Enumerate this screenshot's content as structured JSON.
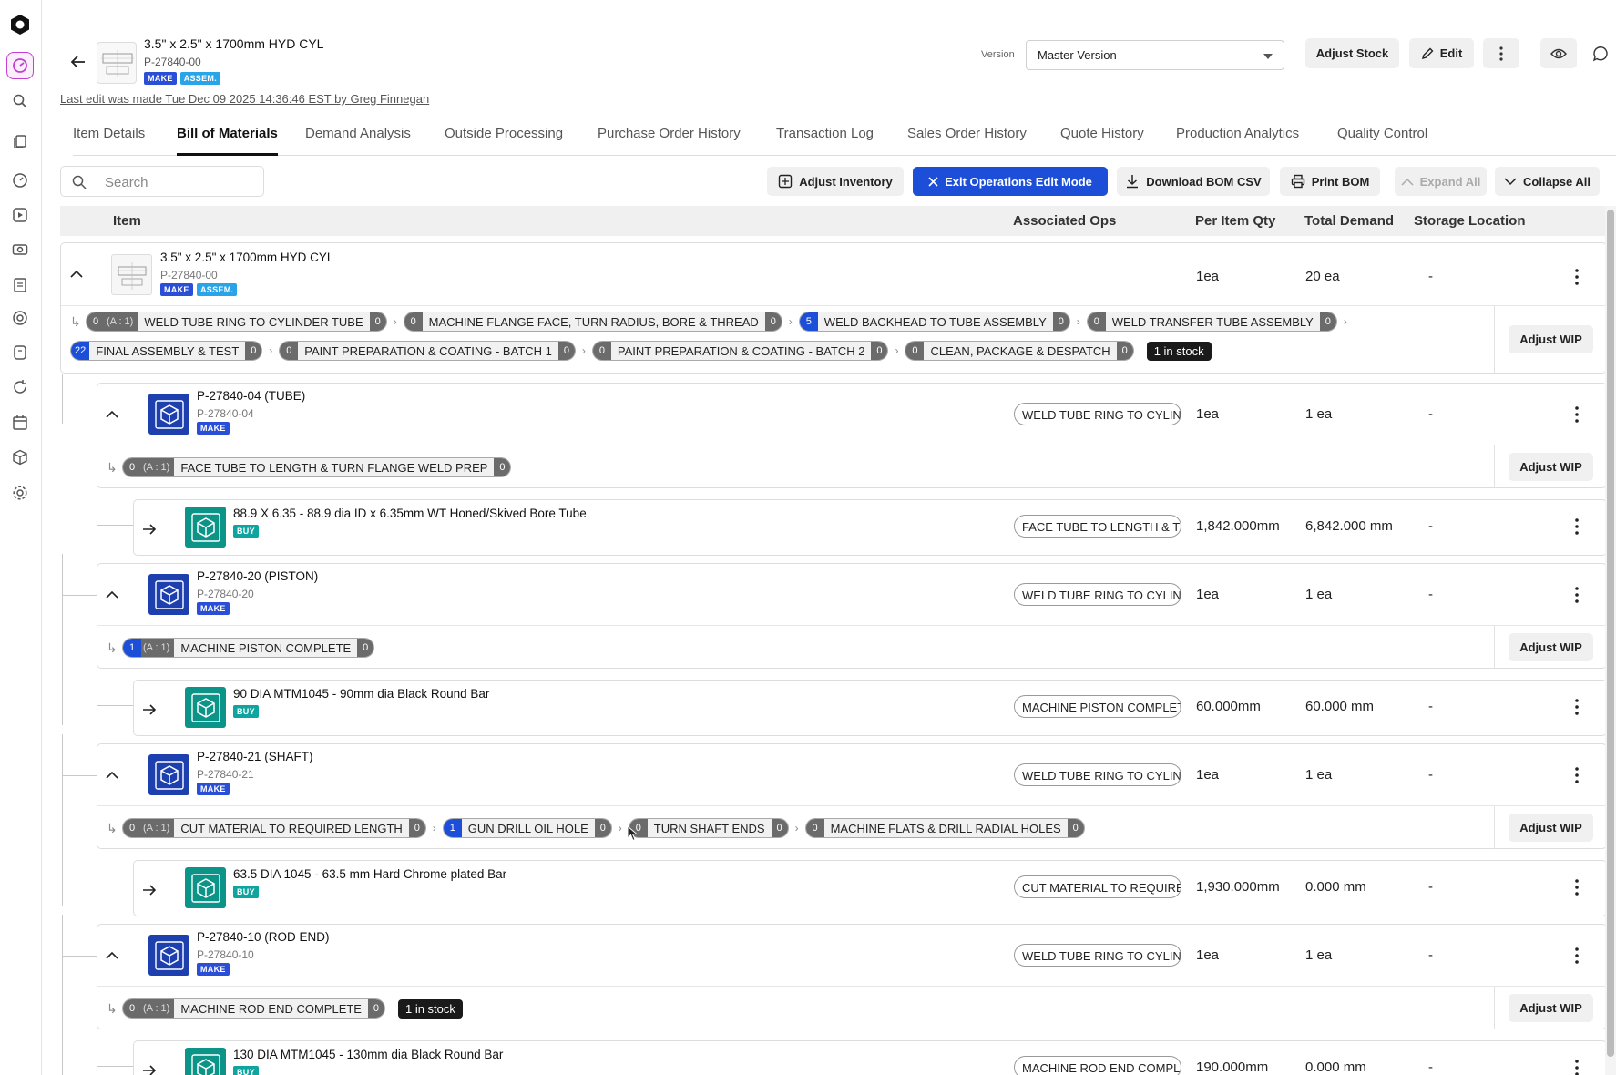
{
  "header": {
    "title": "3.5\" x 2.5\" x 1700mm HYD CYL",
    "part_number": "P-27840-00",
    "tag_make": "MAKE",
    "tag_assem": "ASSEM.",
    "last_edit": "Last edit was made Tue Dec 09 2025 14:36:46 EST by Greg Finnegan",
    "version_label": "Version",
    "version_value": "Master Version",
    "adjust_stock": "Adjust Stock",
    "edit": "Edit"
  },
  "tabs": [
    "Item Details",
    "Bill of Materials",
    "Demand Analysis",
    "Outside Processing",
    "Purchase Order History",
    "Transaction Log",
    "Sales Order History",
    "Quote History",
    "Production Analytics",
    "Quality Control"
  ],
  "toolbar": {
    "search_placeholder": "Search",
    "adjust_inventory": "Adjust Inventory",
    "exit_ops": "Exit Operations Edit Mode",
    "download_csv": "Download BOM CSV",
    "print_bom": "Print BOM",
    "expand_all": "Expand All",
    "collapse_all": "Collapse All"
  },
  "columns": {
    "item": "Item",
    "ops": "Associated Ops",
    "per_item": "Per Item Qty",
    "total": "Total Demand",
    "storage": "Storage Location"
  },
  "labels": {
    "adjust_wip": "Adjust WIP",
    "make": "MAKE",
    "buy": "BUY",
    "assem": "ASSEM.",
    "alloc": "(A : 1)"
  },
  "root": {
    "name": "3.5\" x 2.5\" x 1700mm HYD CYL",
    "pn": "P-27840-00",
    "qty": "1ea",
    "demand": "20 ea",
    "storage": "-",
    "ops_line1": [
      {
        "c": "0",
        "n": "WELD TUBE RING TO CYLINDER TUBE",
        "r": "0",
        "a": true
      },
      {
        "c": "0",
        "n": "MACHINE FLANGE FACE, TURN RADIUS, BORE & THREAD",
        "r": "0"
      },
      {
        "c": "5",
        "n": "WELD BACKHEAD TO TUBE ASSEMBLY",
        "r": "0",
        "blue": true
      },
      {
        "c": "0",
        "n": "WELD TRANSFER TUBE ASSEMBLY",
        "r": "0"
      }
    ],
    "ops_line2": [
      {
        "c": "22",
        "n": "FINAL ASSEMBLY & TEST",
        "r": "0",
        "blue": true
      },
      {
        "c": "0",
        "n": "PAINT PREPARATION & COATING - BATCH 1",
        "r": "0"
      },
      {
        "c": "0",
        "n": "PAINT PREPARATION & COATING - BATCH 2",
        "r": "0"
      },
      {
        "c": "0",
        "n": "CLEAN, PACKAGE & DESPATCH",
        "r": "0"
      }
    ],
    "stock": "1 in stock"
  },
  "subs": [
    {
      "name": "P-27840-04 (TUBE)",
      "pn": "P-27840-04",
      "op": "WELD TUBE RING TO CYLINDER TUBE",
      "qty": "1ea",
      "demand": "1 ea",
      "storage": "-",
      "ops": [
        {
          "c": "0",
          "n": "FACE TUBE TO LENGTH & TURN FLANGE WELD PREP",
          "r": "0",
          "a": true
        }
      ],
      "child": {
        "name": "88.9 X 6.35 - 88.9 dia ID x 6.35mm WT Honed/Skived Bore Tube",
        "op": "FACE TUBE TO LENGTH & TURN FLANGE WELD PREP",
        "qty": "1,842.000mm",
        "demand": "6,842.000 mm",
        "storage": "-"
      }
    },
    {
      "name": "P-27840-20 (PISTON)",
      "pn": "P-27840-20",
      "op": "WELD TUBE RING TO CYLINDER TUBE",
      "qty": "1ea",
      "demand": "1 ea",
      "storage": "-",
      "ops": [
        {
          "c": "1",
          "n": "MACHINE PISTON COMPLETE",
          "r": "0",
          "a": true,
          "blue": true
        }
      ],
      "child": {
        "name": "90 DIA MTM1045 - 90mm dia Black Round Bar",
        "op": "MACHINE PISTON COMPLETE",
        "qty": "60.000mm",
        "demand": "60.000 mm",
        "storage": "-"
      }
    },
    {
      "name": "P-27840-21 (SHAFT)",
      "pn": "P-27840-21",
      "op": "WELD TUBE RING TO CYLINDER TUBE",
      "qty": "1ea",
      "demand": "1 ea",
      "storage": "-",
      "ops": [
        {
          "c": "0",
          "n": "CUT MATERIAL TO REQUIRED LENGTH",
          "r": "0",
          "a": true
        },
        {
          "c": "1",
          "n": "GUN DRILL OIL HOLE",
          "r": "0",
          "blue": true
        },
        {
          "c": "0",
          "n": "TURN SHAFT ENDS",
          "r": "0"
        },
        {
          "c": "0",
          "n": "MACHINE FLATS & DRILL RADIAL HOLES",
          "r": "0"
        }
      ],
      "child": {
        "name": "63.5 DIA 1045 - 63.5 mm Hard Chrome plated Bar",
        "op": "CUT MATERIAL TO REQUIRED LENGTH",
        "qty": "1,930.000mm",
        "demand": "0.000 mm",
        "storage": "-"
      }
    },
    {
      "name": "P-27840-10 (ROD END)",
      "pn": "P-27840-10",
      "op": "WELD TUBE RING TO CYLINDER TUBE",
      "qty": "1ea",
      "demand": "1 ea",
      "storage": "-",
      "ops": [
        {
          "c": "0",
          "n": "MACHINE ROD END COMPLETE",
          "r": "0",
          "a": true
        }
      ],
      "stock": "1 in stock",
      "child": {
        "name": "130 DIA MTM1045 - 130mm dia Black Round Bar",
        "op": "MACHINE ROD END COMPLETE",
        "qty": "190.000mm",
        "demand": "0.000 mm",
        "storage": "-"
      }
    }
  ]
}
